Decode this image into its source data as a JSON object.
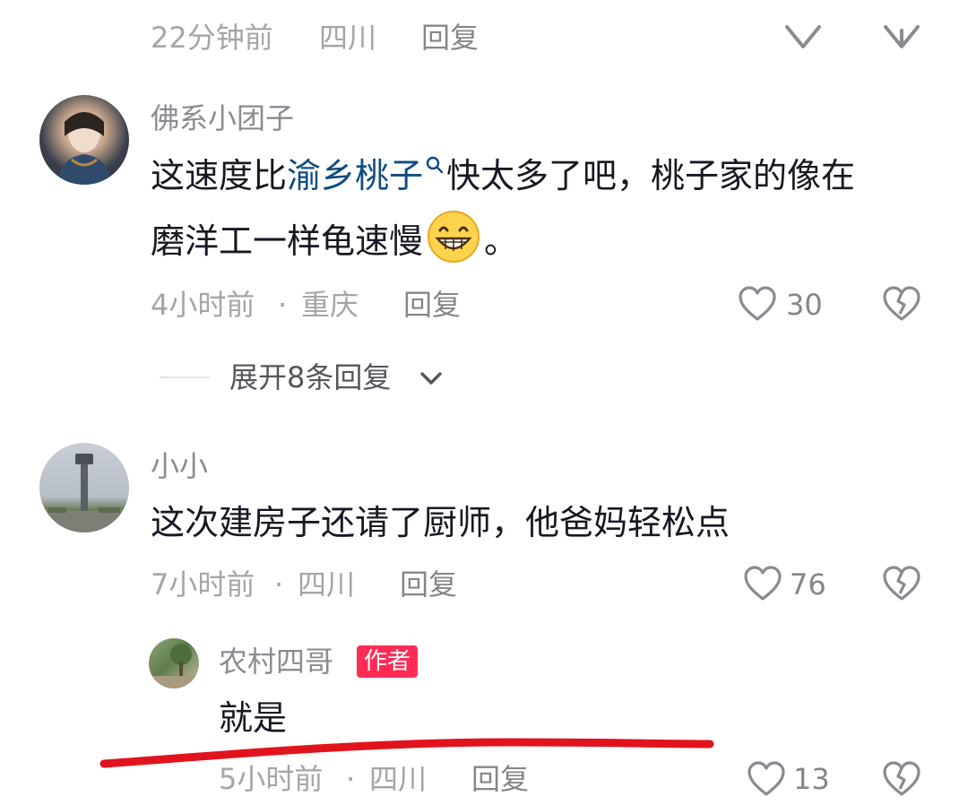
{
  "top_partial": {
    "time": "22分钟前",
    "location": "四川",
    "reply": "回复"
  },
  "comments": [
    {
      "username": "佛系小团子",
      "text_before": "这速度比",
      "keyword": "渝乡桃子",
      "text_after_line1": "快太多了吧，桃子家的像在",
      "text_line2": "磨洋工一样龟速慢",
      "text_end": "。",
      "time": "4小时前",
      "location": "重庆",
      "reply": "回复",
      "likes": "30",
      "expand": "展开8条回复"
    },
    {
      "username": "小小",
      "text": "这次建房子还请了厨师，他爸妈轻松点",
      "time": "7小时前",
      "location": "四川",
      "reply": "回复",
      "likes": "76"
    },
    {
      "username": "农村四哥",
      "badge": "作者",
      "text": "就是",
      "time": "5小时前",
      "location": "四川",
      "reply": "回复",
      "likes": "13"
    }
  ],
  "separator": "·",
  "icons": {
    "like": "heart-outline-icon",
    "dislike": "broken-heart-icon",
    "search": "search-icon",
    "chevron": "chevron-down-icon",
    "emoji": "grinning-face-emoji"
  },
  "colors": {
    "keyword": "#0f4c81",
    "author_badge": "#fe2c55",
    "annotation_underline": "#e1141e"
  }
}
